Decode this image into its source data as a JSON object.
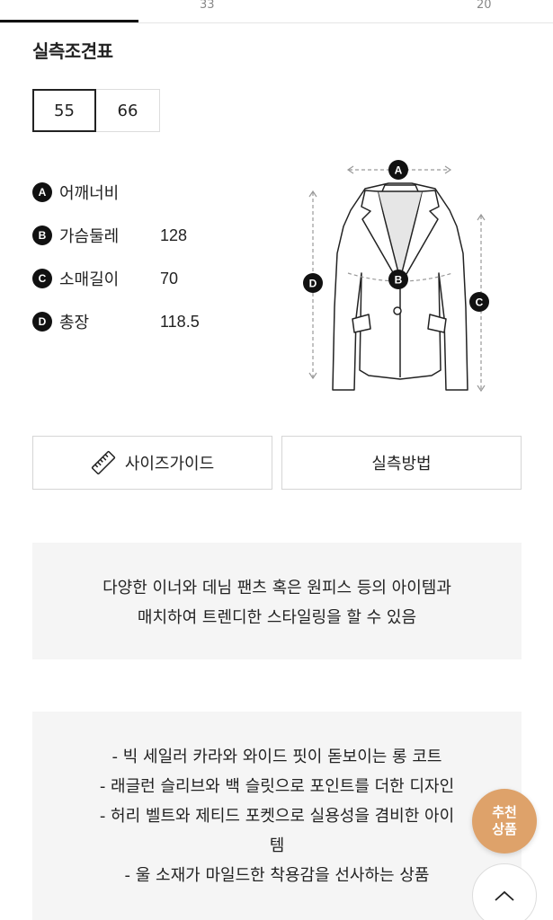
{
  "top_tabs": {
    "left_number": "33",
    "right_number": "20"
  },
  "section_title": "실측조견표",
  "size_options": [
    {
      "label": "55",
      "selected": true
    },
    {
      "label": "66",
      "selected": false
    }
  ],
  "measurements": [
    {
      "badge": "A",
      "label": "어깨너비",
      "value": ""
    },
    {
      "badge": "B",
      "label": "가슴둘레",
      "value": "128"
    },
    {
      "badge": "C",
      "label": "소매길이",
      "value": "70"
    },
    {
      "badge": "D",
      "label": "총장",
      "value": "118.5"
    }
  ],
  "diagram_badges": {
    "a": "A",
    "b": "B",
    "c": "C",
    "d": "D"
  },
  "buttons": {
    "size_guide": "사이즈가이드",
    "measure_method": "실측방법"
  },
  "description_1": [
    "다양한 이너와 데님 팬츠 혹은 원피스 등의 아이템과",
    "매치하여 트렌디한 스타일링을 할 수 있음"
  ],
  "description_2": [
    "- 빅 세일러 카라와 와이드 핏이 돋보이는 롱 코트",
    "- 래글런 슬리브와 백 슬릿으로 포인트를 더한 디자인",
    "- 허리 벨트와 제티드 포켓으로 실용성을 겸비한 아이",
    "템",
    "- 울 소재가 마일드한 착용감을 선사하는 상품"
  ],
  "floating": {
    "recommend_line1": "추천",
    "recommend_line2": "상품"
  },
  "colors": {
    "accent": "#dea26a",
    "box_bg": "#f5f5f5",
    "badge": "#111111"
  }
}
